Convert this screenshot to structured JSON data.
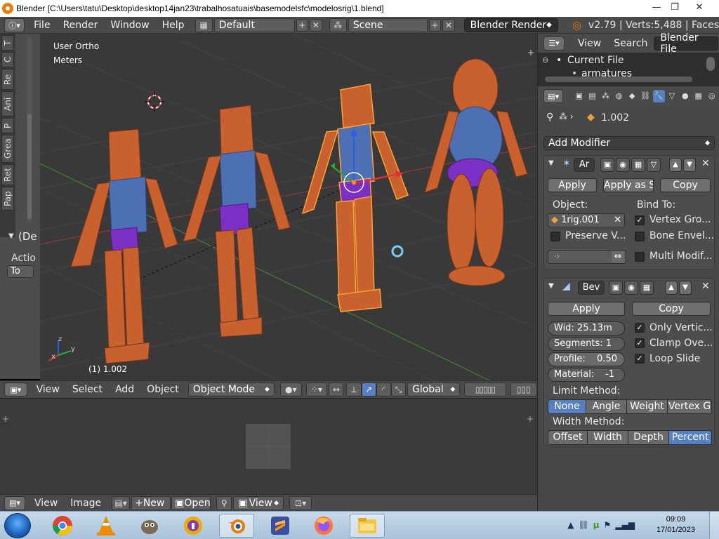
{
  "window": {
    "title": "Blender [C:\\Users\\tatu\\Desktop\\desktop14jan23\\trabalhosatuais\\basemodelsfc\\modelosrig\\1.blend]",
    "minimize": "—",
    "maximize": "❐",
    "close": "✕"
  },
  "info_header": {
    "menus": [
      "File",
      "Render",
      "Window",
      "Help"
    ],
    "layout": "Default",
    "scene": "Scene",
    "engine": "Blender Render",
    "stats": "v2.79 | Verts:5,488 | Faces"
  },
  "tool_shelf": {
    "tabs": [
      "T",
      "C",
      "Re",
      "Ani",
      "P",
      "Grea",
      "Ret",
      "Pap"
    ],
    "operator_title": "(De",
    "operator_label": "Actio",
    "operator_value": "To"
  },
  "viewport": {
    "view_name": "User Ortho",
    "units": "Meters",
    "object_info": "(1) 1.002",
    "axis_x": "x",
    "axis_y": "y",
    "axis_z": "z"
  },
  "viewport_header": {
    "menus": [
      "View",
      "Select",
      "Add",
      "Object"
    ],
    "mode": "Object Mode",
    "orientation": "Global"
  },
  "image_editor_header": {
    "menus": [
      "View",
      "Image"
    ],
    "new_label": "New",
    "open_label": "Open",
    "view_label": "View"
  },
  "outliner": {
    "menus": [
      "View",
      "Search"
    ],
    "display_mode": "Blender File",
    "root": "Current File",
    "child": "armatures"
  },
  "properties": {
    "object_name": "1.002",
    "add_modifier": "Add Modifier",
    "armature_modifier": {
      "name": "Ar",
      "apply": "Apply",
      "apply_as": "Apply as S",
      "copy": "Copy",
      "object_label": "Object:",
      "object_value": "1rig.001",
      "bind_to_label": "Bind To:",
      "vertex_groups": "Vertex Gro...",
      "preserve": "Preserve V...",
      "bone_envelopes": "Bone Envel...",
      "multi_modifier": "Multi Modif..."
    },
    "bevel_modifier": {
      "name": "Bev",
      "apply": "Apply",
      "copy": "Copy",
      "width": "Wid: 25.13m",
      "segments": "Segments: 1",
      "profile_label": "Profile:",
      "profile_value": "0.50",
      "material": "Material:",
      "material_value": "-1",
      "only_vertices": "Only Vertic...",
      "clamp_overlap": "Clamp Ove...",
      "loop_slide": "Loop Slide",
      "limit_method_label": "Limit Method:",
      "limit_methods": [
        "None",
        "Angle",
        "Weight",
        "Vertex G"
      ],
      "limit_selected": "None",
      "width_method_label": "Width Method:",
      "width_methods": [
        "Offset",
        "Width",
        "Depth",
        "Percent"
      ],
      "width_selected": "Percent"
    }
  },
  "taskbar": {
    "time": "09:09",
    "date": "17/01/2023",
    "apps": [
      "chrome-icon",
      "vlc-icon",
      "gimp-icon",
      "security-icon",
      "blender-icon",
      "sublime-icon",
      "firefox-icon",
      "explorer-icon"
    ],
    "active_app": "blender-icon"
  },
  "colors": {
    "header_bg": "#4a4a4a",
    "viewport_bg": "#393939",
    "accent_blue": "#5680c2",
    "skin_orange": "#c9602f",
    "torso_blue": "#4d6fb3",
    "hips_purple": "#7a2fc2",
    "selection_orange": "#ffa033"
  }
}
